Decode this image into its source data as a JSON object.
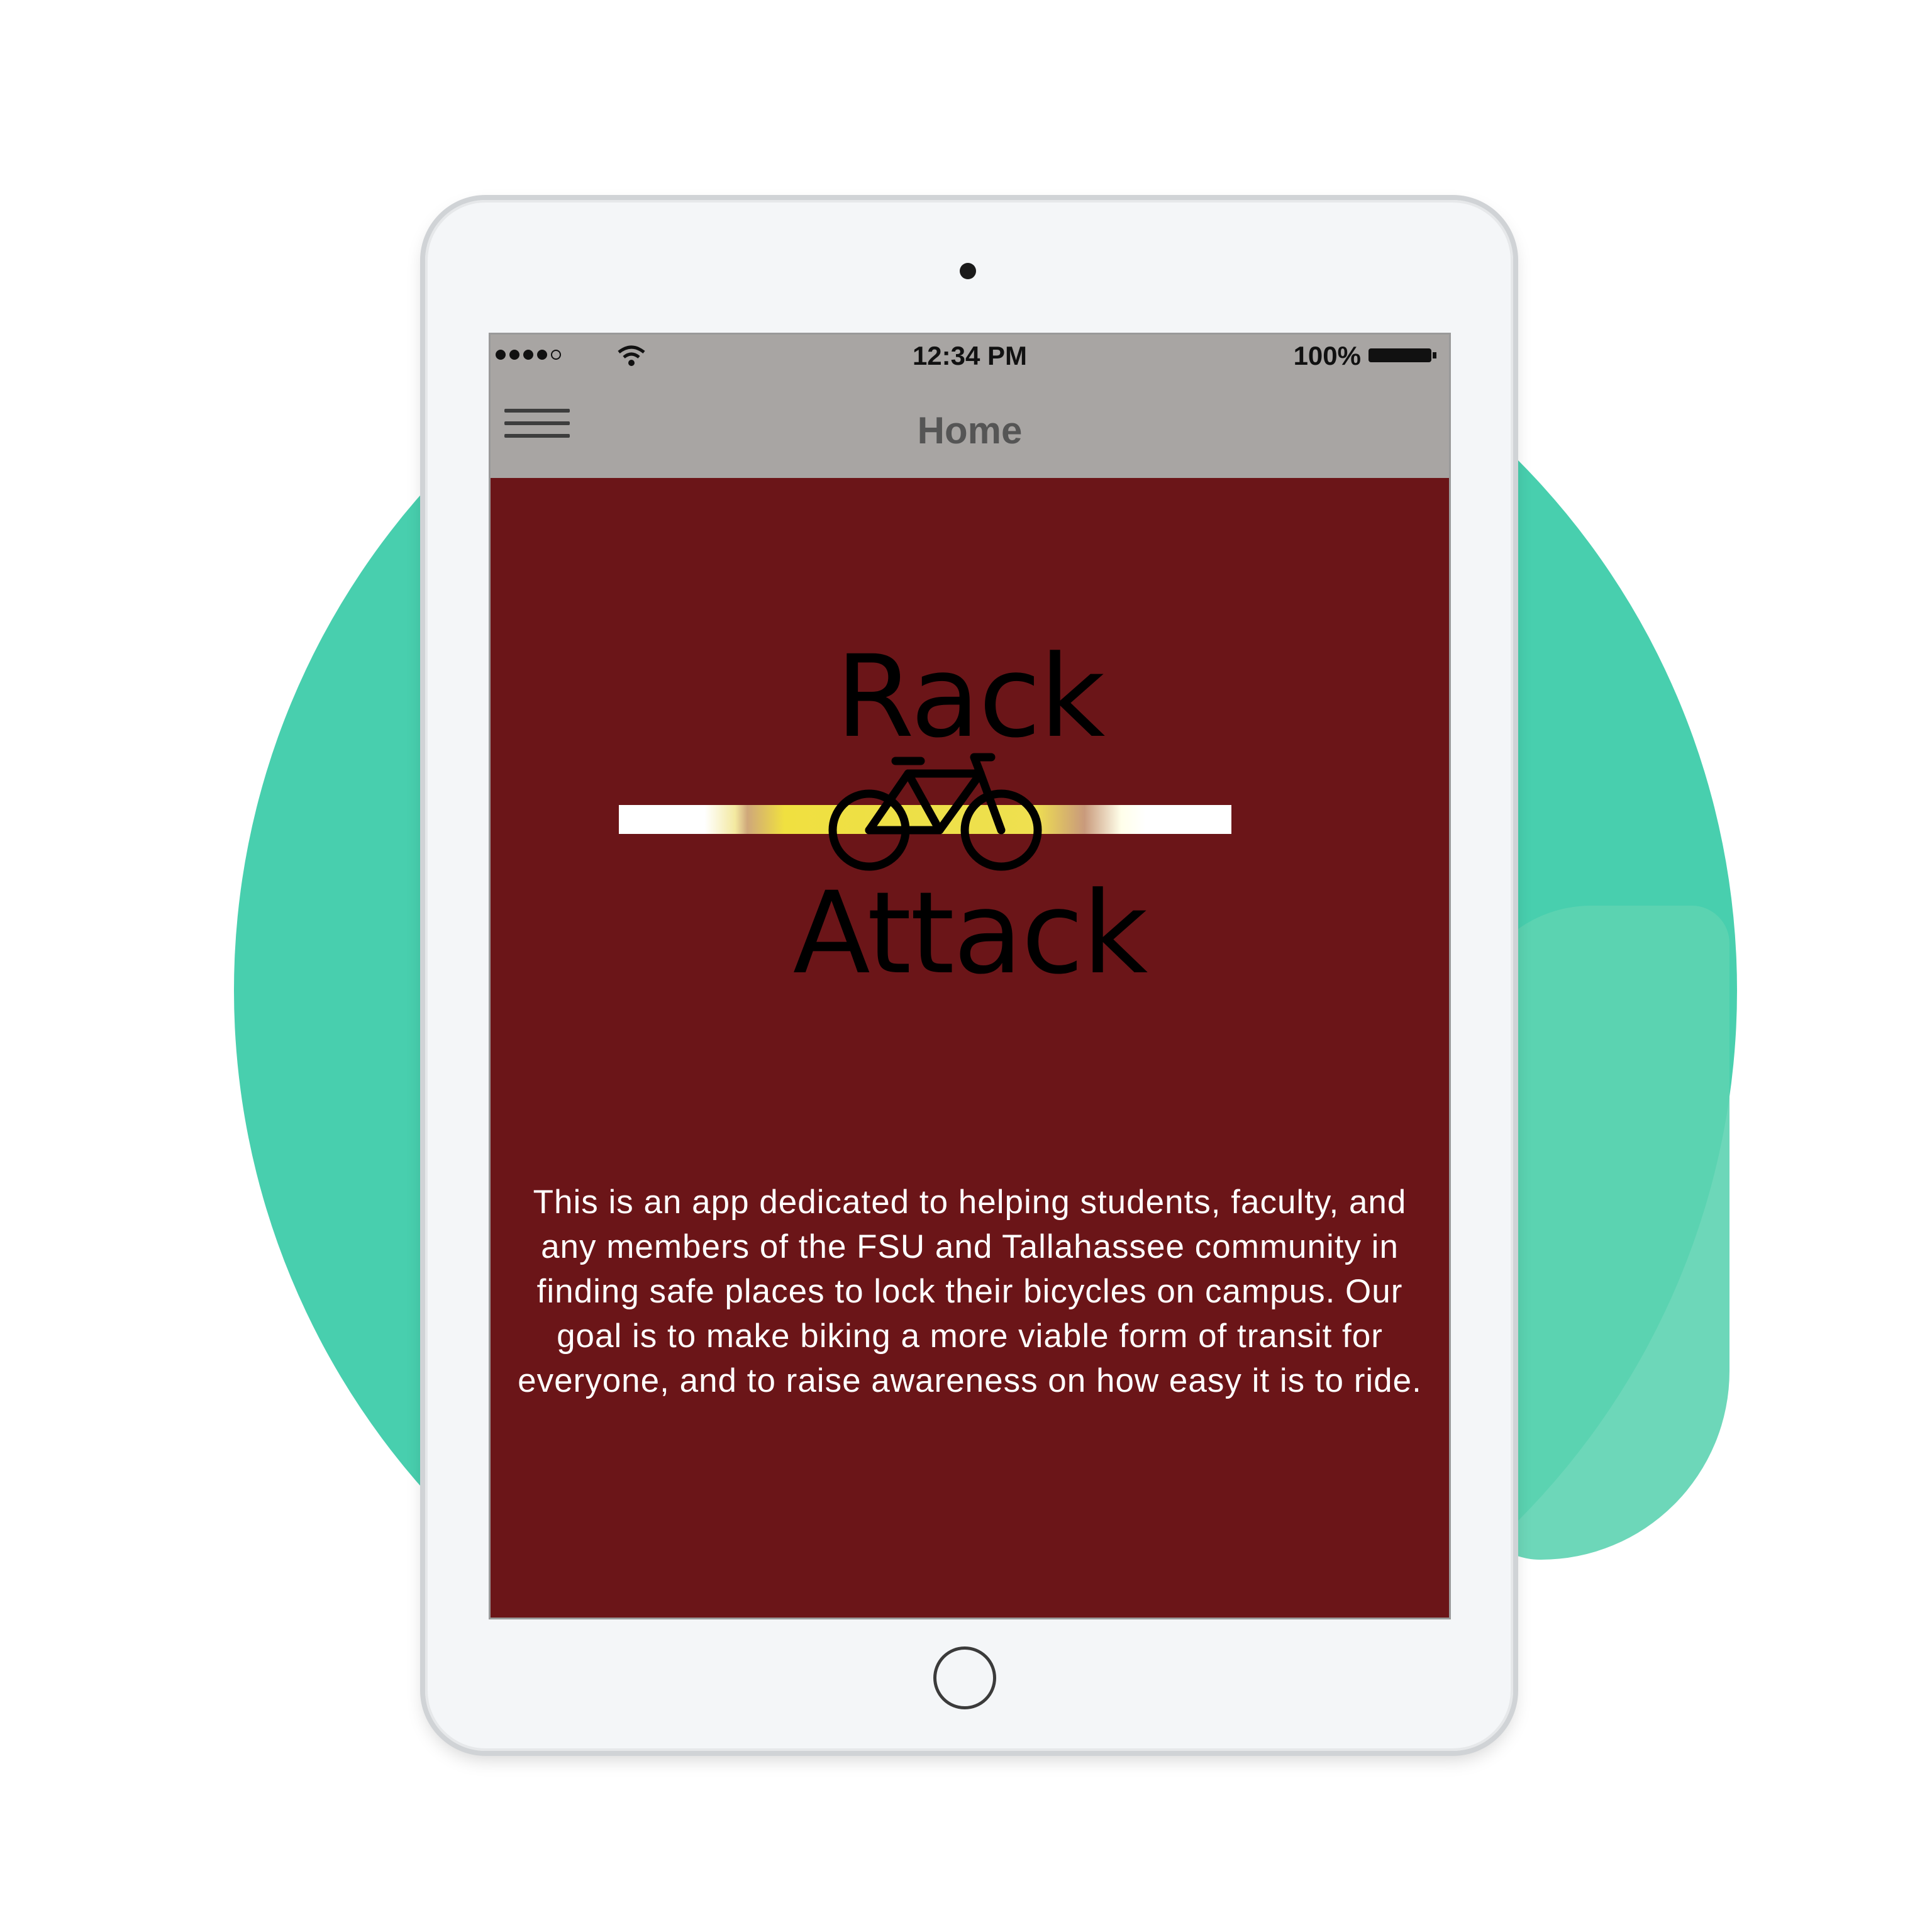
{
  "status_bar": {
    "time": "12:34 PM",
    "battery": "100%"
  },
  "nav": {
    "title": "Home"
  },
  "logo": {
    "line1": "Rack",
    "line2": "Attack"
  },
  "description": {
    "text": "This is an app dedicated to helping students, faculty, and any members of the FSU and Tallahassee community in finding safe places to lock their bicycles on campus. Our goal is to make biking a more viable form of transit for everyone, and to raise awareness on how easy it is to ride."
  },
  "icons": {
    "menu": "hamburger-menu-icon",
    "wifi": "wifi-icon",
    "battery": "battery-icon",
    "bike": "bicycle-icon"
  },
  "colors": {
    "background_circle": "#48cfae",
    "screen": "#6b1518",
    "bars": "#a8a5a3",
    "stripe_accent": "#ede048"
  }
}
